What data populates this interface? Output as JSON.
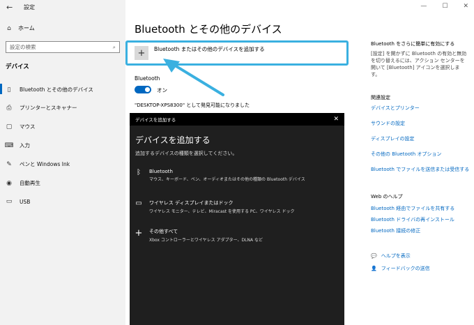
{
  "window": {
    "title": "設定",
    "back": "←",
    "controls": [
      "—",
      "☐",
      "✕"
    ]
  },
  "sidebar": {
    "home": "ホーム",
    "search_placeholder": "設定の検索",
    "section": "デバイス",
    "items": [
      {
        "label": "Bluetooth とその他のデバイス",
        "icon": "bluetooth-devices-icon",
        "active": true
      },
      {
        "label": "プリンターとスキャナー",
        "icon": "printer-icon"
      },
      {
        "label": "マウス",
        "icon": "mouse-icon"
      },
      {
        "label": "入力",
        "icon": "keyboard-icon"
      },
      {
        "label": "ペンと Windows Ink",
        "icon": "pen-icon"
      },
      {
        "label": "自動再生",
        "icon": "autoplay-icon"
      },
      {
        "label": "USB",
        "icon": "usb-icon"
      }
    ]
  },
  "main": {
    "title": "Bluetooth とその他のデバイス",
    "add_device": "Bluetooth またはその他のデバイスを追加する",
    "bluetooth_label": "Bluetooth",
    "toggle_state": "オン",
    "discoverable": "\"DESKTOP-XPS8300\" として発見可能になりました"
  },
  "right_panel": {
    "easy_title": "Bluetooth をさらに簡単に有効にする",
    "easy_text": "[設定] を開かずに Bluetooth の有効と無効を切り替えるには、アクション センターを開いて [Bluetooth] アイコンを選択します。",
    "related_heading": "関連設定",
    "related_links": [
      "デバイスとプリンター",
      "サウンドの設定",
      "ディスプレイの設定",
      "その他の Bluetooth オプション",
      "Bluetooth でファイルを送信または受信する"
    ],
    "help_heading": "Web のヘルプ",
    "help_links": [
      "Bluetooth 経由でファイルを共有する",
      "Bluetooth ドライバの再インストール",
      "Bluetooth 接続の修正"
    ],
    "get_help": "ヘルプを表示",
    "feedback": "フィードバックの送信"
  },
  "dialog": {
    "title": "デバイスを追加する",
    "heading": "デバイスを追加する",
    "subtitle": "追加するデバイスの種類を選択してください。",
    "options": [
      {
        "title": "Bluetooth",
        "desc": "マウス、キーボード、ペン、オーディオまたはその他の種類の Bluetooth デバイス",
        "icon": "bluetooth-icon"
      },
      {
        "title": "ワイヤレス ディスプレイまたはドック",
        "desc": "ワイヤレス モニター、テレビ、Miracast を使用する PC、ワイヤレス ドック",
        "icon": "monitor-icon"
      },
      {
        "title": "その他すべて",
        "desc": "Xbox コントローラーとワイヤレス アダプター、DLNA など",
        "icon": "plus-icon"
      }
    ]
  },
  "colors": {
    "accent": "#0067c0",
    "highlight": "#3ab0e0",
    "dialog_bg": "#1f1f1f"
  }
}
